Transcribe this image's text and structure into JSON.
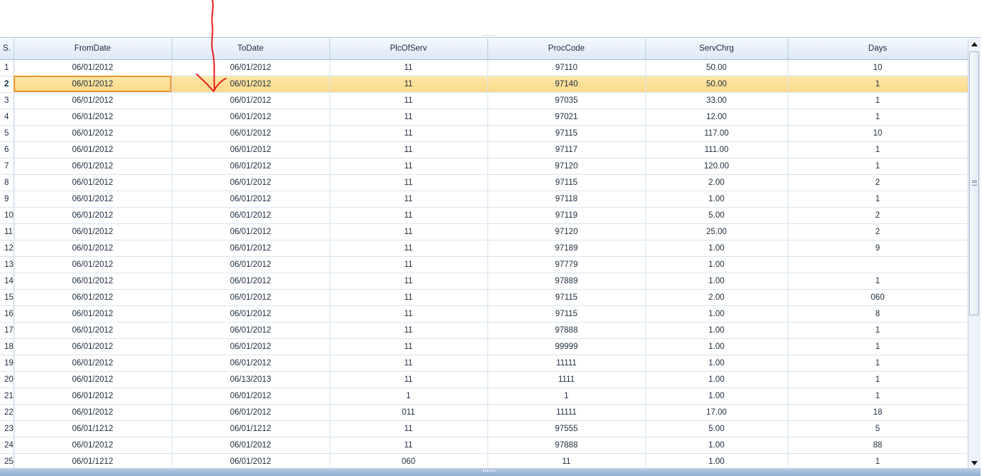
{
  "grid": {
    "columns": [
      "S.",
      "FromDate",
      "ToDate",
      "PlcOfServ",
      "ProcCode",
      "ServChrg",
      "Days"
    ],
    "selected_row_index": 1,
    "rows": [
      [
        "1",
        "06/01/2012",
        "06/01/2012",
        "11",
        "97110",
        "50.00",
        "10"
      ],
      [
        "2",
        "06/01/2012",
        "06/01/2012",
        "11",
        "97140",
        "50.00",
        "1"
      ],
      [
        "3",
        "06/01/2012",
        "06/01/2012",
        "11",
        "97035",
        "33.00",
        "1"
      ],
      [
        "4",
        "06/01/2012",
        "06/01/2012",
        "11",
        "97021",
        "12.00",
        "1"
      ],
      [
        "5",
        "06/01/2012",
        "06/01/2012",
        "11",
        "97115",
        "117.00",
        "10"
      ],
      [
        "6",
        "06/01/2012",
        "06/01/2012",
        "11",
        "97117",
        "111.00",
        "1"
      ],
      [
        "7",
        "06/01/2012",
        "06/01/2012",
        "11",
        "97120",
        "120.00",
        "1"
      ],
      [
        "8",
        "06/01/2012",
        "06/01/2012",
        "11",
        "97115",
        "2.00",
        "2"
      ],
      [
        "9",
        "06/01/2012",
        "06/01/2012",
        "11",
        "97118",
        "1.00",
        "1"
      ],
      [
        "10",
        "06/01/2012",
        "06/01/2012",
        "11",
        "97119",
        "5.00",
        "2"
      ],
      [
        "11",
        "06/01/2012",
        "06/01/2012",
        "11",
        "97120",
        "25.00",
        "2"
      ],
      [
        "12",
        "06/01/2012",
        "06/01/2012",
        "11",
        "97189",
        "1.00",
        "9"
      ],
      [
        "13",
        "06/01/2012",
        "06/01/2012",
        "11",
        "97779",
        "1.00",
        ""
      ],
      [
        "14",
        "06/01/2012",
        "06/01/2012",
        "11",
        "97889",
        "1.00",
        "1"
      ],
      [
        "15",
        "06/01/2012",
        "06/01/2012",
        "11",
        "97115",
        "2.00",
        "060"
      ],
      [
        "16",
        "06/01/2012",
        "06/01/2012",
        "11",
        "97115",
        "1.00",
        "8"
      ],
      [
        "17",
        "06/01/2012",
        "06/01/2012",
        "11",
        "97888",
        "1.00",
        "1"
      ],
      [
        "18",
        "06/01/2012",
        "06/01/2012",
        "11",
        "99999",
        "1.00",
        "1"
      ],
      [
        "19",
        "06/01/2012",
        "06/01/2012",
        "11",
        "11111",
        "1.00",
        "1"
      ],
      [
        "20",
        "06/01/2012",
        "06/13/2013",
        "11",
        "1111",
        "1.00",
        "1"
      ],
      [
        "21",
        "06/01/2012",
        "06/01/2012",
        "1",
        "1",
        "1.00",
        "1"
      ],
      [
        "22",
        "06/01/2012",
        "06/01/2012",
        "011",
        "11111",
        "17.00",
        "18"
      ],
      [
        "23",
        "06/01/1212",
        "06/01/1212",
        "11",
        "97555",
        "5.00",
        "5"
      ],
      [
        "24",
        "06/01/2012",
        "06/01/2012",
        "11",
        "97888",
        "1.00",
        "88"
      ],
      [
        "25",
        "06/01/1212",
        "06/01/2012",
        "060",
        "11",
        "1.00",
        "1"
      ]
    ]
  },
  "scrollbar": {
    "up_icon": "triangle-up-icon",
    "down_icon": "triangle-down-icon"
  },
  "colors": {
    "selection": "#fbd98a",
    "active_cell_border": "#f0952e",
    "annotation": "#e8201e"
  }
}
